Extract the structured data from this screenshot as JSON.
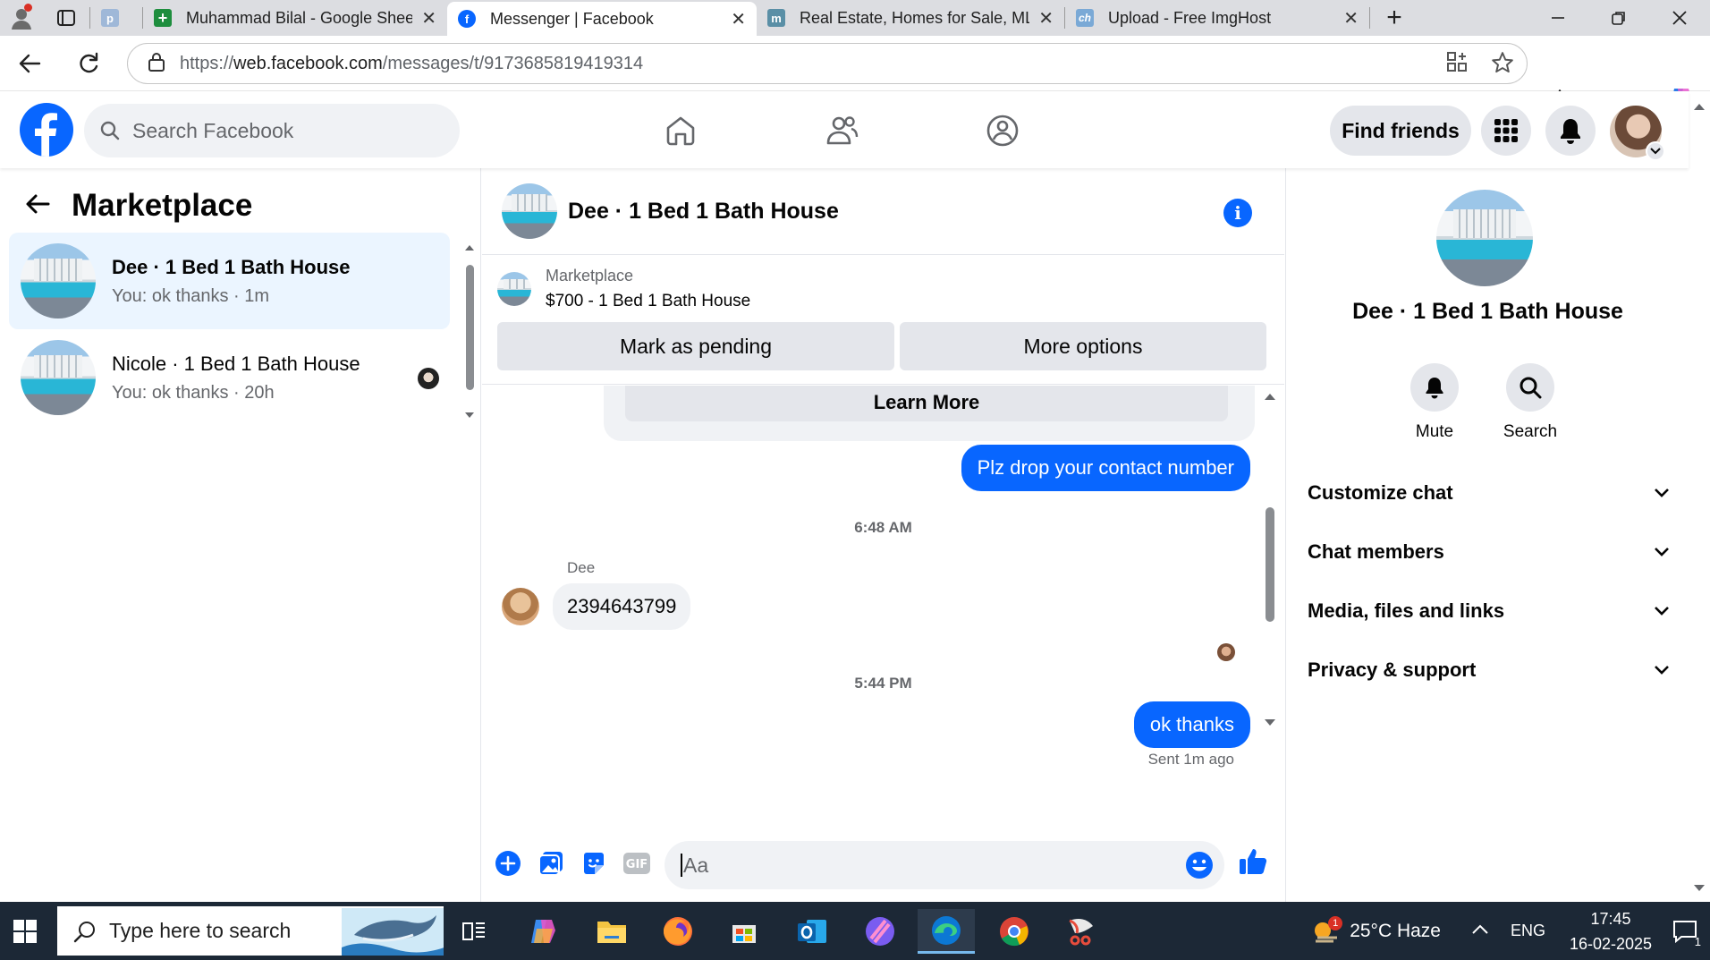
{
  "browser": {
    "tabs": [
      {
        "title": "",
        "color": "#9fb8d8",
        "letter": "p",
        "active": false,
        "closable": false
      },
      {
        "title": "Muhammad Bilal - Google Sheets",
        "color": "#1e8e3e",
        "letter": "+",
        "active": false,
        "closable": true
      },
      {
        "title": "Messenger | Facebook",
        "color": "#0866ff",
        "letter": "f",
        "active": true,
        "closable": true
      },
      {
        "title": "Real Estate, Homes for Sale, MLS",
        "color": "#5a8fa6",
        "letter": "m",
        "active": false,
        "closable": true
      },
      {
        "title": "Upload - Free ImgHost",
        "color": "#7aa9d6",
        "letter": "ch",
        "active": false,
        "closable": true
      }
    ],
    "url_prefix": "https://",
    "url_host": "web.facebook.com",
    "url_path": "/messages/t/9173685819419314"
  },
  "facebook": {
    "search_placeholder": "Search Facebook",
    "find_friends": "Find friends"
  },
  "marketplace": {
    "title": "Marketplace",
    "conversations": [
      {
        "name": "Dee · 1 Bed 1 Bath House",
        "preview": "You: ok thanks · 1m",
        "active": true
      },
      {
        "name": "Nicole · 1 Bed 1 Bath House",
        "preview": "You: ok thanks · 20h",
        "active": false
      }
    ]
  },
  "chat": {
    "header_name": "Dee · 1 Bed 1 Bath House",
    "listing_label": "Marketplace",
    "listing_price": "$700 - 1 Bed 1 Bath House",
    "mark_pending": "Mark as pending",
    "more_options": "More options",
    "learn_more": "Learn More",
    "messages": {
      "out1": "Plz drop your contact number",
      "time1": "6:48 AM",
      "sender": "Dee",
      "in1": "2394643799",
      "time2": "5:44 PM",
      "out2": "ok thanks",
      "sent_note": "Sent 1m ago"
    },
    "input_placeholder": "Aa"
  },
  "info_panel": {
    "name": "Dee · 1 Bed 1 Bath House",
    "mute": "Mute",
    "search": "Search",
    "sections": [
      "Customize chat",
      "Chat members",
      "Media, files and links",
      "Privacy & support"
    ]
  },
  "taskbar": {
    "search_placeholder": "Type here to search",
    "weather": "25°C  Haze",
    "weather_badge": "1",
    "lang": "ENG",
    "time": "17:45",
    "date": "16-02-2025",
    "notif_count": "1"
  }
}
